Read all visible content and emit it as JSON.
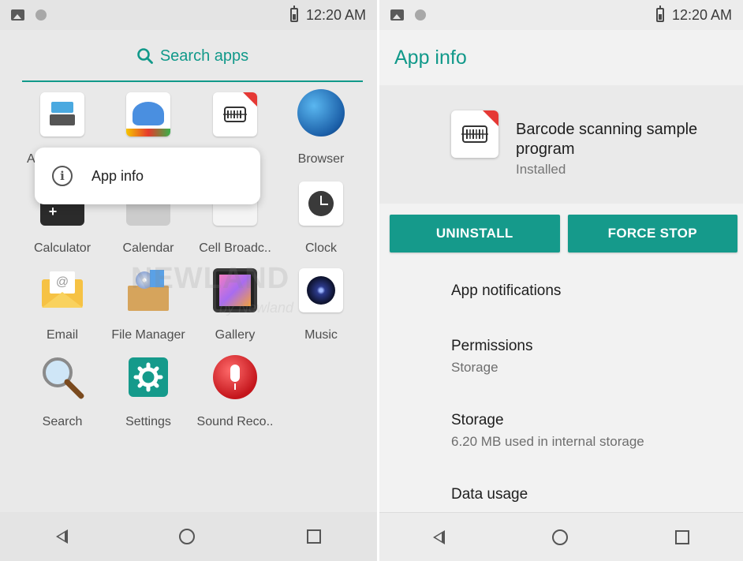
{
  "status_bar": {
    "time": "12:20 AM"
  },
  "launcher": {
    "search_label": "Search apps",
    "apps": [
      {
        "label": "A",
        "icon": "keyboard-icon"
      },
      {
        "label": "",
        "icon": "bird-icon"
      },
      {
        "label": "",
        "icon": "barcode-icon"
      },
      {
        "label": "Browser",
        "icon": "globe-icon"
      },
      {
        "label": "Calculator",
        "icon": "calculator-icon"
      },
      {
        "label": "Calendar",
        "icon": "calendar-icon"
      },
      {
        "label": "Cell Broadc..",
        "icon": "cell-broadcast-icon"
      },
      {
        "label": "Clock",
        "icon": "clock-icon"
      },
      {
        "label": "Email",
        "icon": "email-icon"
      },
      {
        "label": "File Manager",
        "icon": "file-manager-icon"
      },
      {
        "label": "Gallery",
        "icon": "gallery-icon"
      },
      {
        "label": "Music",
        "icon": "music-icon"
      },
      {
        "label": "Search",
        "icon": "magnifier-icon"
      },
      {
        "label": "Settings",
        "icon": "settings-icon"
      },
      {
        "label": "Sound Reco..",
        "icon": "microphone-icon"
      }
    ],
    "popup": {
      "label": "App info",
      "icon": "info-icon"
    },
    "watermark": {
      "text": "NEWLAND",
      "sub": "by Newland"
    }
  },
  "app_info": {
    "title": "App info",
    "app_name": "Barcode scanning sample program",
    "app_status": "Installed",
    "buttons": {
      "uninstall": "UNINSTALL",
      "force_stop": "FORCE STOP"
    },
    "rows": [
      {
        "title": "App notifications",
        "sub": ""
      },
      {
        "title": "Permissions",
        "sub": "Storage"
      },
      {
        "title": "Storage",
        "sub": "6.20 MB used in internal storage"
      },
      {
        "title": "Data usage",
        "sub": ""
      }
    ]
  },
  "colors": {
    "accent": "#11998a",
    "button": "#159a8b"
  }
}
